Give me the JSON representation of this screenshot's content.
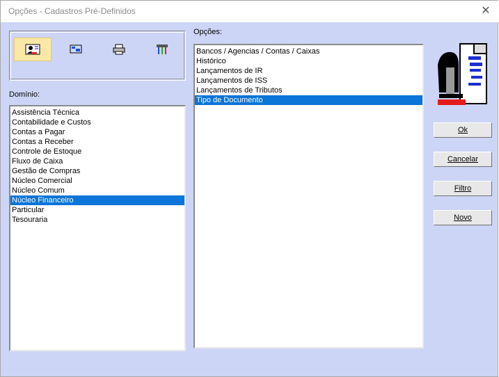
{
  "window": {
    "title": "Opções - Cadastros Pré-Definidos",
    "close_glyph": "✕"
  },
  "toolbar": {
    "buttons": [
      {
        "icon": "user-card-icon",
        "active": true
      },
      {
        "icon": "screen-icon",
        "active": false
      },
      {
        "icon": "printer-icon",
        "active": false
      },
      {
        "icon": "tools-icon",
        "active": false
      }
    ]
  },
  "dominio": {
    "label": "Domínio:",
    "items": [
      "Assistência Técnica",
      "Contabilidade e Custos",
      "Contas a Pagar",
      "Contas a Receber",
      "Controle de Estoque",
      "Fluxo de Caixa",
      "Gestão de Compras",
      "Núcleo Comercial",
      "Núcleo Comum",
      "Núcleo Financeiro",
      "Particular",
      "Tesouraria"
    ],
    "selected_index": 9
  },
  "opcoes": {
    "label": "Opções:",
    "items": [
      "Bancos / Agencias / Contas / Caixas",
      "Histórico",
      "Lançamentos de IR",
      "Lançamentos de ISS",
      "Lançamentos de Tributos",
      "Tipo de Documento"
    ],
    "selected_index": 5
  },
  "buttons": {
    "ok": "Ok",
    "cancelar": "Cancelar",
    "filtro": "Filtro",
    "novo": "Novo"
  },
  "colors": {
    "background": "#ccd5f5",
    "selection": "#0a74d8",
    "active_tool": "#fbe7a6"
  }
}
